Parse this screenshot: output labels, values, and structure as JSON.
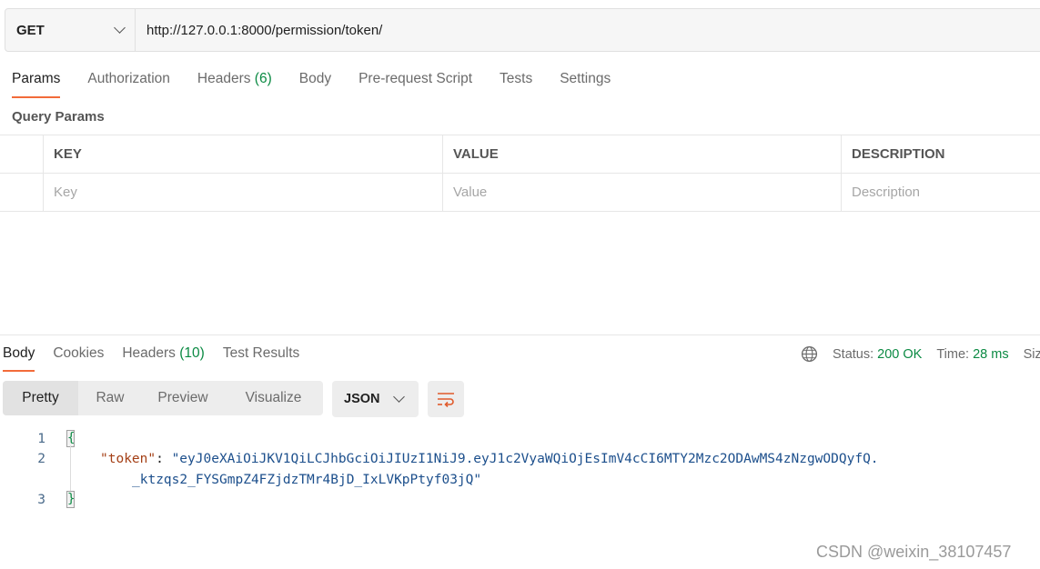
{
  "request": {
    "method": "GET",
    "url": "http://127.0.0.1:8000/permission/token/"
  },
  "request_tabs": [
    {
      "label": "Params",
      "count": ""
    },
    {
      "label": "Authorization",
      "count": ""
    },
    {
      "label": "Headers",
      "count": "(6)"
    },
    {
      "label": "Body",
      "count": ""
    },
    {
      "label": "Pre-request Script",
      "count": ""
    },
    {
      "label": "Tests",
      "count": ""
    },
    {
      "label": "Settings",
      "count": ""
    }
  ],
  "query_params": {
    "title": "Query Params",
    "headers": [
      "KEY",
      "VALUE",
      "DESCRIPTION"
    ],
    "placeholders": [
      "Key",
      "Value",
      "Description"
    ]
  },
  "response_tabs": [
    {
      "label": "Body",
      "count": ""
    },
    {
      "label": "Cookies",
      "count": ""
    },
    {
      "label": "Headers",
      "count": "(10)"
    },
    {
      "label": "Test Results",
      "count": ""
    }
  ],
  "status": {
    "status_label": "Status:",
    "status_value": "200 OK",
    "time_label": "Time:",
    "time_value": "28 ms",
    "size_label": "Siz"
  },
  "view_modes": [
    "Pretty",
    "Raw",
    "Preview",
    "Visualize"
  ],
  "format": "JSON",
  "code": {
    "line_numbers": [
      "1",
      "2",
      "3"
    ],
    "open_brace": "{",
    "close_brace": "}",
    "key": "\"token\"",
    "colon": ": ",
    "value_part1": "\"eyJ0eXAiOiJKV1QiLCJhbGciOiJIUzI1NiJ9.eyJ1c2VyaWQiOjEsImV4cCI6MTY2Mzc2ODAwMS4zNzgwODQyfQ.",
    "value_part2": "_ktzqs2_FYSGmpZ4FZjdzTMr4BjD_IxLVKpPtyf03jQ\""
  },
  "watermark": "CSDN @weixin_38107457",
  "colors": {
    "accent": "#f26b3a",
    "success": "#0b8a43"
  }
}
